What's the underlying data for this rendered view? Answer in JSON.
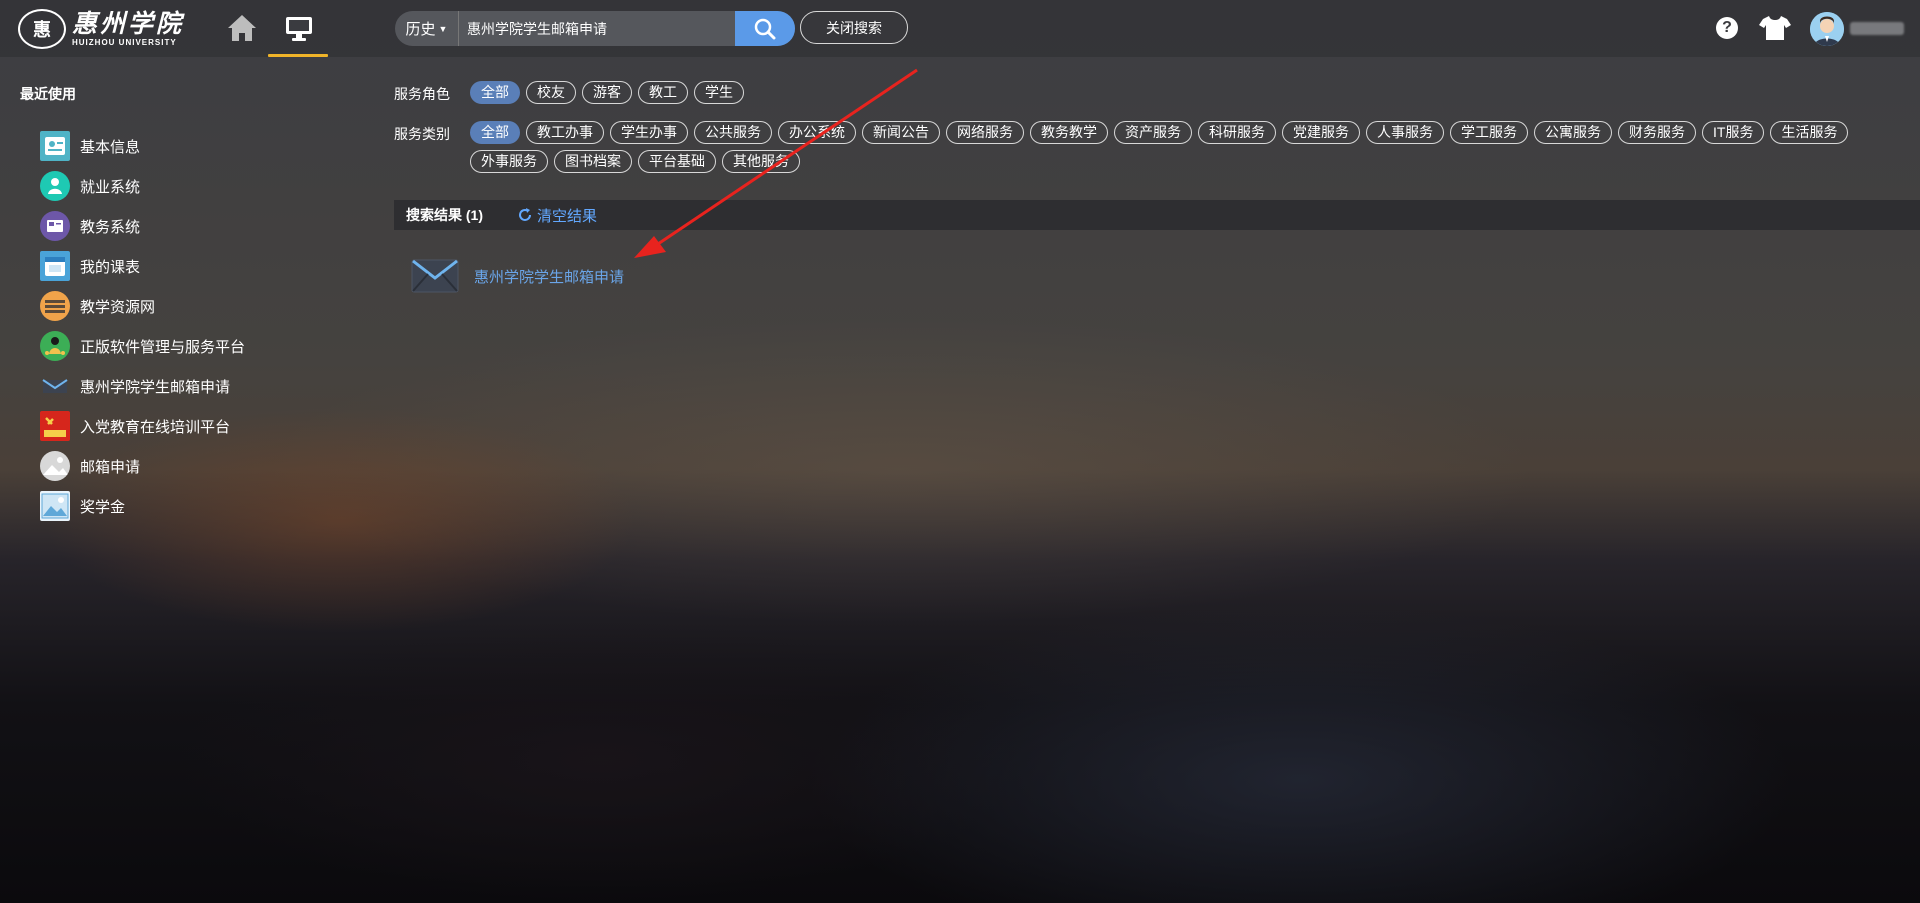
{
  "header": {
    "logo_cn": "惠州学院",
    "logo_en": "HUIZHOU UNIVERSITY",
    "search": {
      "history_label": "历史",
      "query": "惠州学院学生邮箱申请"
    },
    "close_search_label": "关闭搜索",
    "help_glyph": "?"
  },
  "sidebar": {
    "title": "最近使用",
    "items": [
      {
        "label": "基本信息",
        "icon": "profile-icon",
        "color": "#4fb3c6"
      },
      {
        "label": "就业系统",
        "icon": "employment-icon",
        "color": "#1ec9b3"
      },
      {
        "label": "教务系统",
        "icon": "academic-icon",
        "color": "#6d57a8"
      },
      {
        "label": "我的课表",
        "icon": "timetable-icon",
        "color": "#4aa3d8"
      },
      {
        "label": "教学资源网",
        "icon": "resources-icon",
        "color": "#f0a34a"
      },
      {
        "label": "正版软件管理与服务平台",
        "icon": "software-icon",
        "color": "#3cae56"
      },
      {
        "label": "惠州学院学生邮箱申请",
        "icon": "mail-icon",
        "color": "#3c4350"
      },
      {
        "label": "入党教育在线培训平台",
        "icon": "party-icon",
        "color": "#d6261c"
      },
      {
        "label": "邮箱申请",
        "icon": "placeholder-icon",
        "color": "#d8d8d8"
      },
      {
        "label": "奖学金",
        "icon": "image-icon",
        "color": "#5fa8d8"
      }
    ]
  },
  "filters": {
    "role_label": "服务角色",
    "roles": [
      "全部",
      "校友",
      "游客",
      "教工",
      "学生"
    ],
    "category_label": "服务类别",
    "categories": [
      "全部",
      "教工办事",
      "学生办事",
      "公共服务",
      "办公系统",
      "新闻公告",
      "网络服务",
      "教务教学",
      "资产服务",
      "科研服务",
      "党建服务",
      "人事服务",
      "学工服务",
      "公寓服务",
      "财务服务",
      "IT服务",
      "生活服务",
      "外事服务",
      "图书档案",
      "平台基础",
      "其他服务"
    ]
  },
  "results": {
    "count_label": "搜索结果 (1)",
    "clear_label": "清空结果",
    "items": [
      {
        "label": "惠州学院学生邮箱申请",
        "icon": "mail-icon"
      }
    ]
  },
  "colors": {
    "accent": "#5b9ae8",
    "chip_active": "#5a7fb8",
    "link": "#62a8ff",
    "tab_underline": "#f0b429",
    "annotation_arrow": "#e8231e"
  }
}
